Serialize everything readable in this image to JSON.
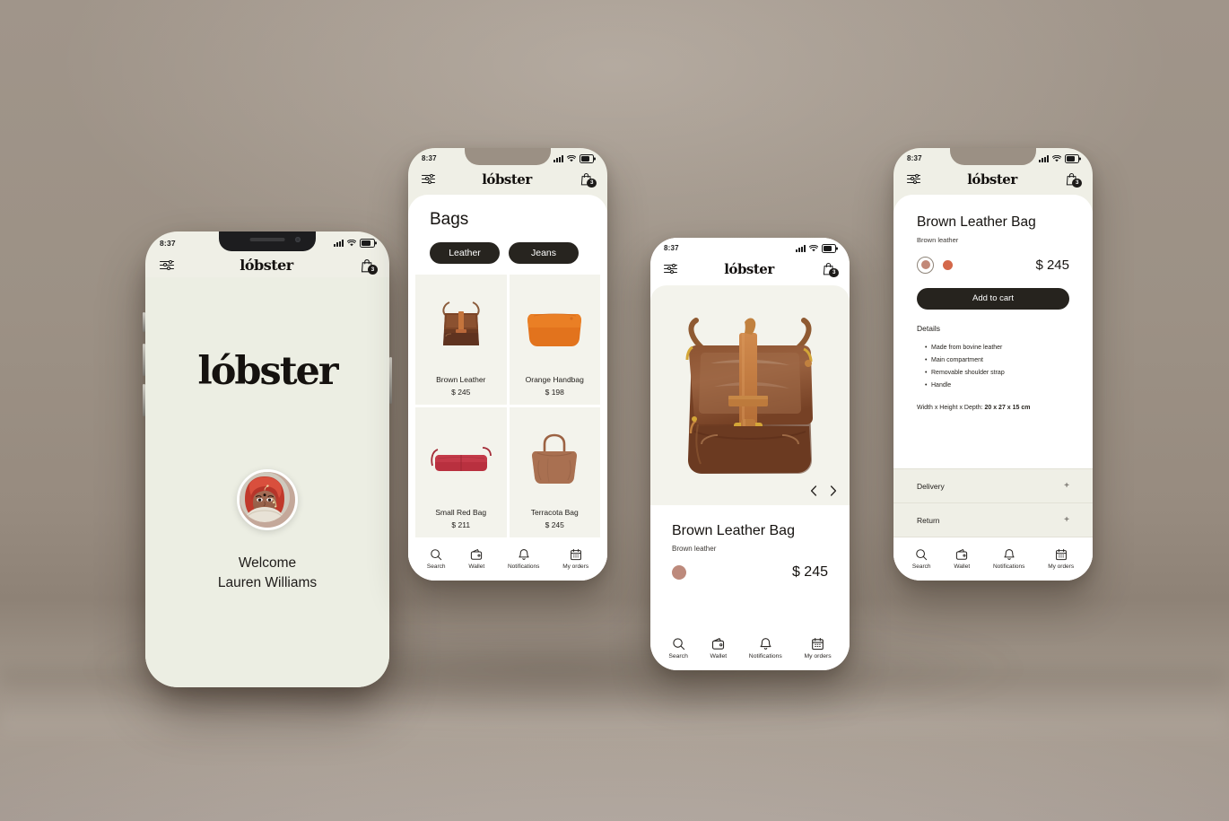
{
  "brand": "lóbster",
  "status": {
    "time": "8:37"
  },
  "appbar": {
    "filter_icon": "sliders-filter-icon",
    "cart_icon": "shopping-bag-icon",
    "cart_count": "3"
  },
  "colors": {
    "background": "#9b9084",
    "screen_cream": "#efefe6",
    "card_cream": "#f3f3ec",
    "ink": "#1d1b19",
    "swatch_selected": "#c28878",
    "swatch_alt": "#d4684a",
    "swatch_hero": "#bd8a7c"
  },
  "nav": {
    "items": [
      {
        "label": "Search",
        "icon": "search-icon"
      },
      {
        "label": "Wallet",
        "icon": "wallet-icon"
      },
      {
        "label": "Notifications",
        "icon": "bell-icon"
      },
      {
        "label": "My orders",
        "icon": "calendar-icon"
      }
    ]
  },
  "phone1": {
    "brand_big": "lóbster",
    "avatar": "user-avatar",
    "welcome_line1": "Welcome",
    "welcome_line2": "Lauren Williams"
  },
  "phone2": {
    "title": "Bags",
    "chips": [
      "Leather",
      "Jeans"
    ],
    "products": [
      {
        "name": "Brown Leather",
        "price": "$ 245",
        "image": "brown-leather-messenger-bag"
      },
      {
        "name": "Orange Handbag",
        "price": "$ 198",
        "image": "orange-handbag"
      },
      {
        "name": "Small Red Bag",
        "price": "$ 211",
        "image": "small-red-shoulder-bag"
      },
      {
        "name": "Terracota Bag",
        "price": "$ 245",
        "image": "terracota-tote-bag"
      }
    ]
  },
  "phone3": {
    "hero_image": "brown-leather-messenger-bag-large",
    "prev_arrow": "chevron-left-icon",
    "next_arrow": "chevron-right-icon",
    "title": "Brown Leather Bag",
    "subtitle": "Brown leather",
    "price": "$ 245"
  },
  "phone4": {
    "title": "Brown Leather Bag",
    "subtitle": "Brown leather",
    "price": "$ 245",
    "cta": "Add to cart",
    "details_label": "Details",
    "details": [
      "Made from bovine leather",
      "Main compartment",
      "Removable shoulder strap",
      "Handle"
    ],
    "dimensions_label": "Width x Height x Depth:",
    "dimensions_value": "20 x 27 x 15 cm",
    "accordion": [
      {
        "label": "Delivery",
        "expander": "+"
      },
      {
        "label": "Return",
        "expander": "+"
      }
    ]
  }
}
